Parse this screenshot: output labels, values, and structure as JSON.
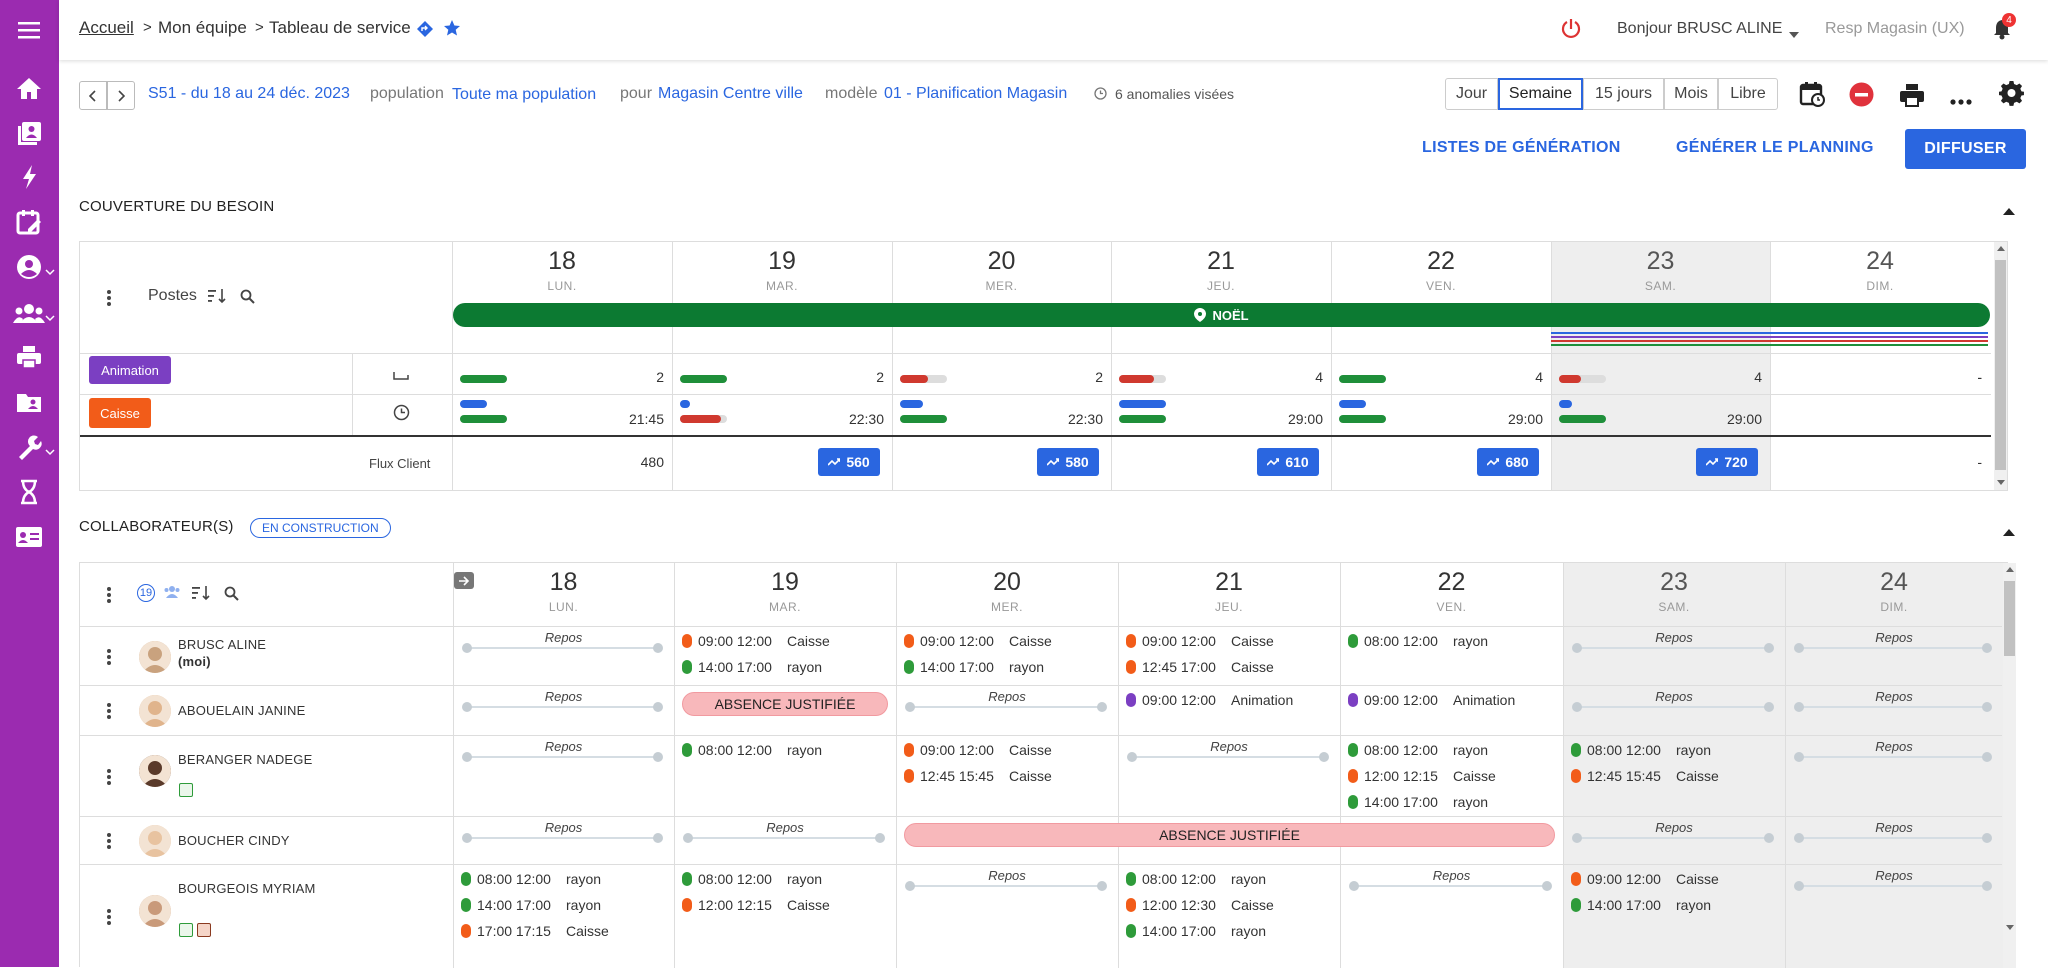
{
  "breadcrumb": {
    "home": "Accueil",
    "team": "Mon équipe",
    "current": "Tableau de service"
  },
  "user": {
    "greeting": "Bonjour BRUSC ALINE",
    "role": "Resp Magasin (UX)",
    "notifications": "4"
  },
  "toolbar": {
    "period": "S51 - du 18 au 24 déc. 2023",
    "population_label": "population",
    "population_value": "Toute ma population",
    "pour_label": "pour",
    "pour_value": "Magasin Centre ville",
    "model_label": "modèle",
    "model_value": "01 - Planification Magasin",
    "anomalies": "6 anomalies visées",
    "views": [
      "Jour",
      "Semaine",
      "15 jours",
      "Mois",
      "Libre"
    ],
    "active_view": "Semaine"
  },
  "actions": {
    "lists": "LISTES DE GÉNÉRATION",
    "generate": "GÉNÉRER LE PLANNING",
    "publish": "DIFFUSER"
  },
  "coverage": {
    "title": "COUVERTURE DU BESOIN",
    "postes_label": "Postes",
    "event": "NOËL",
    "days": [
      {
        "num": "18",
        "name": "LUN."
      },
      {
        "num": "19",
        "name": "MAR."
      },
      {
        "num": "20",
        "name": "MER."
      },
      {
        "num": "21",
        "name": "JEU."
      },
      {
        "num": "22",
        "name": "VEN."
      },
      {
        "num": "23",
        "name": "SAM."
      },
      {
        "num": "24",
        "name": "DIM."
      }
    ],
    "animation_label": "Animation",
    "caisse_label": "Caisse",
    "animation_counts": [
      "2",
      "2",
      "2",
      "4",
      "4",
      "4",
      "-"
    ],
    "caisse_hours": [
      "21:45",
      "22:30",
      "22:30",
      "29:00",
      "29:00",
      "29:00",
      "-"
    ],
    "flux_label": "Flux Client",
    "flux_values": [
      "480",
      "560",
      "580",
      "610",
      "680",
      "720",
      "-"
    ],
    "colors": {
      "animation": "#7b3fc2",
      "caisse": "#f25c19",
      "noel": "#0c7a32"
    }
  },
  "collaborators": {
    "title": "COLLABORATEUR(S)",
    "badge": "EN CONSTRUCTION",
    "count": "19",
    "repos_label": "Repos",
    "absence_label": "ABSENCE JUSTIFIÉE",
    "people": [
      {
        "name": "BRUSC ALINE",
        "sub": "(moi)",
        "shifts": [
          [],
          [
            {
              "t": "09:00 12:00",
              "j": "Caisse",
              "c": "o"
            },
            {
              "t": "14:00 17:00",
              "j": "rayon",
              "c": "g"
            }
          ],
          [
            {
              "t": "09:00 12:00",
              "j": "Caisse",
              "c": "o"
            },
            {
              "t": "14:00 17:00",
              "j": "rayon",
              "c": "g"
            }
          ],
          [
            {
              "t": "09:00 12:00",
              "j": "Caisse",
              "c": "o"
            },
            {
              "t": "12:45 17:00",
              "j": "Caisse",
              "c": "o"
            }
          ],
          [
            {
              "t": "08:00 12:00",
              "j": "rayon",
              "c": "g"
            }
          ],
          [],
          []
        ]
      },
      {
        "name": "ABOUELAIN JANINE",
        "sub": "",
        "shifts": [
          [],
          [],
          [],
          [
            {
              "t": "09:00 12:00",
              "j": "Animation",
              "c": "p"
            }
          ],
          [
            {
              "t": "09:00 12:00",
              "j": "Animation",
              "c": "p"
            }
          ],
          [],
          []
        ]
      },
      {
        "name": "BERANGER NADEGE",
        "sub": "",
        "shifts": [
          [],
          [
            {
              "t": "08:00 12:00",
              "j": "rayon",
              "c": "g"
            }
          ],
          [
            {
              "t": "09:00 12:00",
              "j": "Caisse",
              "c": "o"
            },
            {
              "t": "12:45 15:45",
              "j": "Caisse",
              "c": "o"
            }
          ],
          [],
          [
            {
              "t": "08:00 12:00",
              "j": "rayon",
              "c": "g"
            },
            {
              "t": "12:00 12:15",
              "j": "Caisse",
              "c": "o"
            },
            {
              "t": "14:00 17:00",
              "j": "rayon",
              "c": "g"
            }
          ],
          [
            {
              "t": "08:00 12:00",
              "j": "rayon",
              "c": "g"
            },
            {
              "t": "12:45 15:45",
              "j": "Caisse",
              "c": "o"
            }
          ],
          []
        ]
      },
      {
        "name": "BOUCHER CINDY",
        "sub": "",
        "shifts": [
          [],
          [],
          [],
          [],
          [],
          [],
          []
        ]
      },
      {
        "name": "BOURGEOIS MYRIAM",
        "sub": "",
        "shifts": [
          [
            {
              "t": "08:00 12:00",
              "j": "rayon",
              "c": "g"
            },
            {
              "t": "14:00 17:00",
              "j": "rayon",
              "c": "g"
            },
            {
              "t": "17:00 17:15",
              "j": "Caisse",
              "c": "o"
            }
          ],
          [
            {
              "t": "08:00 12:00",
              "j": "rayon",
              "c": "g"
            },
            {
              "t": "12:00 12:15",
              "j": "Caisse",
              "c": "o"
            }
          ],
          [],
          [
            {
              "t": "08:00 12:00",
              "j": "rayon",
              "c": "g"
            },
            {
              "t": "12:00 12:30",
              "j": "Caisse",
              "c": "o"
            },
            {
              "t": "14:00 17:00",
              "j": "rayon",
              "c": "g"
            }
          ],
          [],
          [
            {
              "t": "09:00 12:00",
              "j": "Caisse",
              "c": "o"
            },
            {
              "t": "14:00 17:00",
              "j": "rayon",
              "c": "g"
            }
          ],
          []
        ]
      }
    ]
  }
}
